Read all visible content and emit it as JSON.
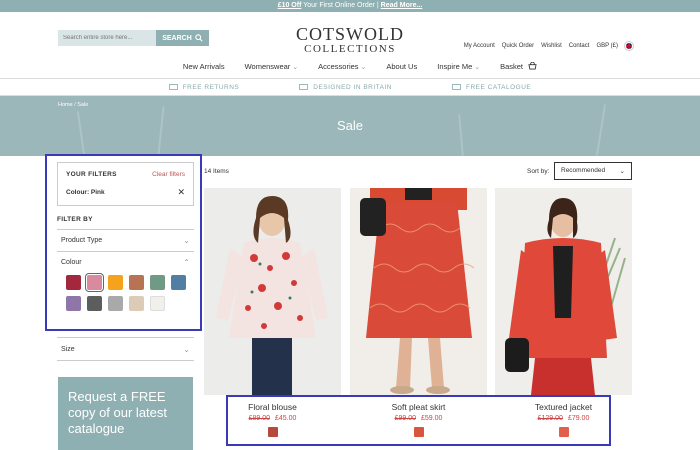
{
  "promo": {
    "offer": "£10 Off",
    "text": " Your First Online Order | ",
    "link": "Read More..."
  },
  "search": {
    "placeholder": "Search entire store here...",
    "button": "SEARCH"
  },
  "logo": {
    "line1": "COTSWOLD",
    "line2": "COLLECTIONS"
  },
  "utility": [
    "My Account",
    "Quick Order",
    "Wishlist",
    "Contact",
    "GBP (£)"
  ],
  "nav": [
    {
      "label": "New Arrivals"
    },
    {
      "label": "Womenswear"
    },
    {
      "label": "Accessories"
    },
    {
      "label": "About Us"
    },
    {
      "label": "Inspire Me"
    },
    {
      "label": "Basket"
    }
  ],
  "usp": [
    "FREE RETURNS",
    "DESIGNED IN BRITAIN",
    "FREE CATALOGUE"
  ],
  "banner": {
    "breadcrumb": "Home  /  Sale",
    "title": "Sale"
  },
  "filters": {
    "title": "YOUR FILTERS",
    "clear": "Clear filters",
    "active": "Colour: Pink",
    "filter_by": "FILTER BY",
    "product_type": "Product Type",
    "colour": "Colour",
    "size": "Size",
    "swatches": [
      "#a3283e",
      "#d98a9f",
      "#f5a21d",
      "#b87355",
      "#6f9a86",
      "#527ea3",
      "#8e76a8",
      "#5b5e5d",
      "#a9a9a9",
      "#dccbb6",
      "#f2f0ea"
    ],
    "selected_index": 1
  },
  "cta": {
    "text": "Request a FREE copy of our latest catalogue"
  },
  "listing": {
    "count": "14 Items",
    "sort_label": "Sort by:",
    "sort_value": "Recommended"
  },
  "products": [
    {
      "name": "Floral blouse",
      "was": "£89.00",
      "now": "£45.00",
      "swatch": "#b54a3a"
    },
    {
      "name": "Soft pleat skirt",
      "was": "£99.00",
      "now": "£59.00",
      "swatch": "#d8553f"
    },
    {
      "name": "Textured jacket",
      "was": "£129.00",
      "now": "£79.00",
      "swatch": "#e0604d"
    }
  ]
}
